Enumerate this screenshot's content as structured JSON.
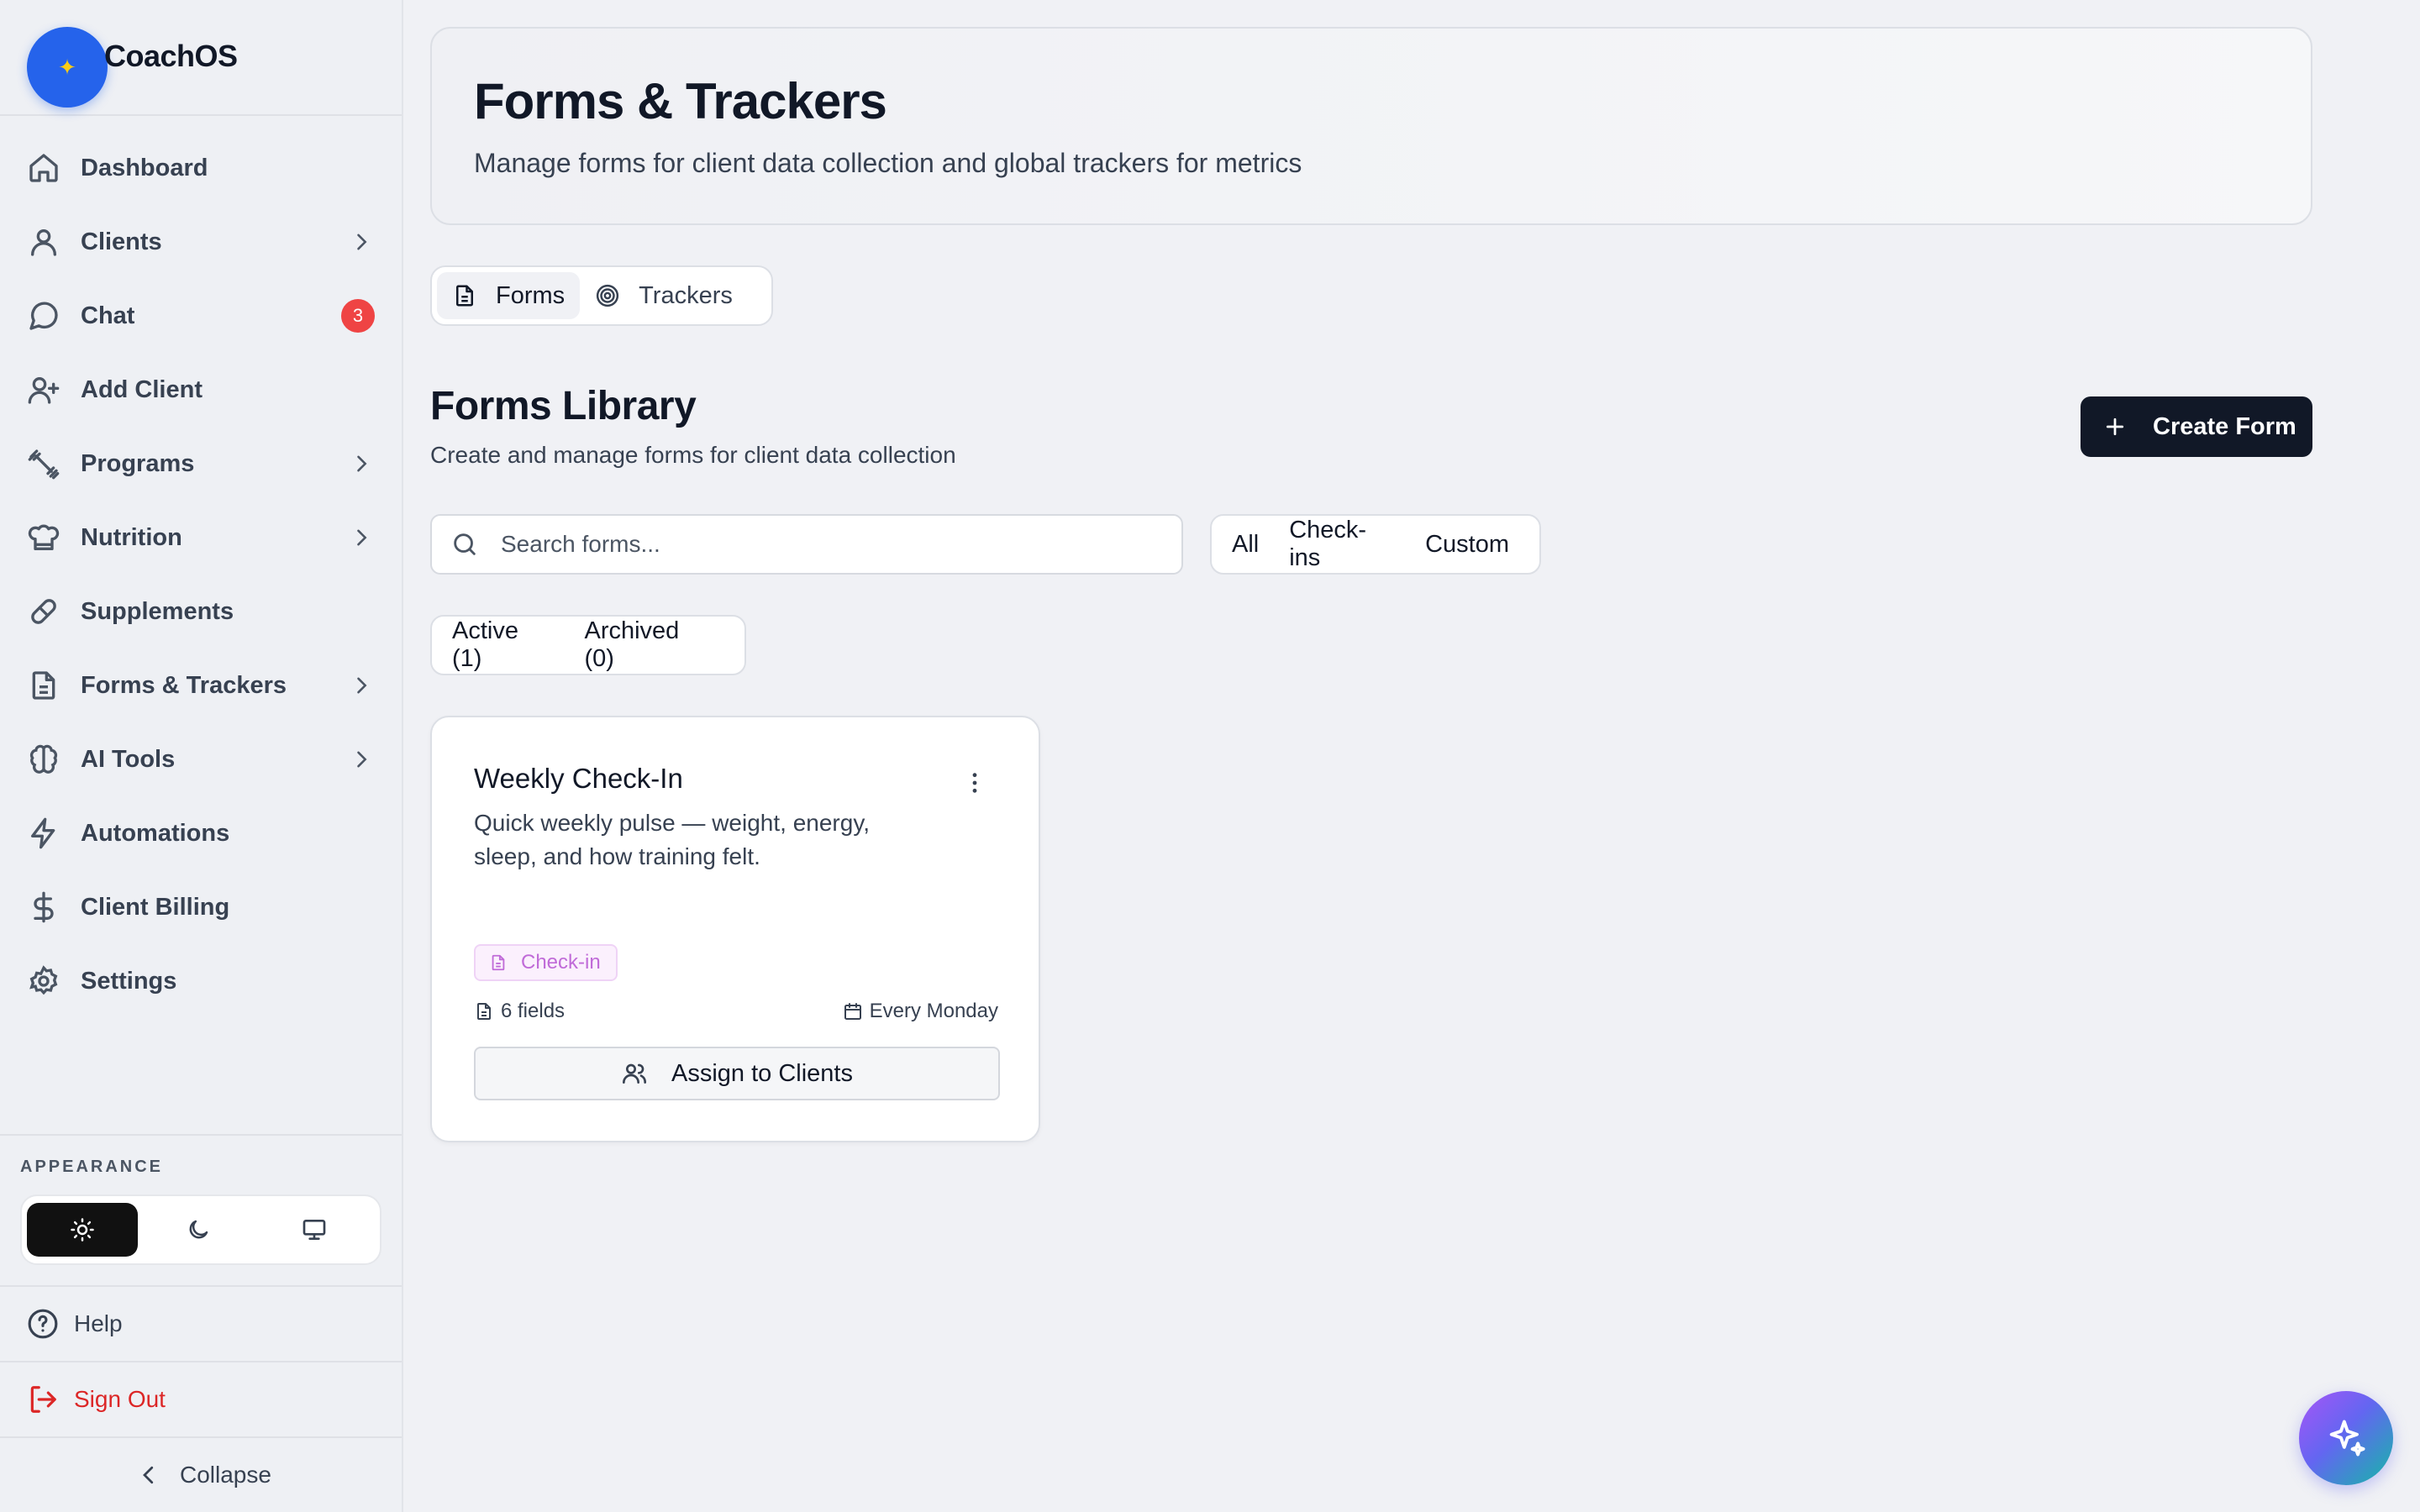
{
  "brand": {
    "name": "CoachOS"
  },
  "nav": {
    "dashboard": "Dashboard",
    "clients": "Clients",
    "chat": "Chat",
    "chat_badge": "3",
    "add_client": "Add Client",
    "programs": "Programs",
    "nutrition": "Nutrition",
    "supplements": "Supplements",
    "forms_trackers": "Forms & Trackers",
    "ai_tools": "AI Tools",
    "automations": "Automations",
    "client_billing": "Client Billing",
    "settings": "Settings"
  },
  "appearance": {
    "label": "APPEARANCE",
    "selected": "light"
  },
  "footer": {
    "help": "Help",
    "sign_out": "Sign Out",
    "collapse": "Collapse"
  },
  "header": {
    "title": "Forms & Trackers",
    "subtitle": "Manage forms for client data collection and global trackers for metrics"
  },
  "tabs": {
    "forms": "Forms",
    "trackers": "Trackers",
    "active": "Forms"
  },
  "library": {
    "title": "Forms Library",
    "subtitle": "Create and manage forms for client data collection",
    "create_label": "Create Form",
    "search_placeholder": "Search forms...",
    "filters": {
      "all": "All",
      "checkins": "Check-ins",
      "custom": "Custom"
    },
    "status": {
      "active": "Active (1)",
      "archived": "Archived (0)"
    }
  },
  "form_card": {
    "title": "Weekly Check-In",
    "description": "Quick weekly pulse — weight, energy, sleep, and how training felt.",
    "badge": "Check-in",
    "fields": "6 fields",
    "schedule": "Every Monday",
    "assign_label": "Assign to Clients"
  },
  "colors": {
    "accent": "#2563eb",
    "primary_button": "#111827",
    "badge": "#c06bd8",
    "danger": "#dc2626"
  }
}
